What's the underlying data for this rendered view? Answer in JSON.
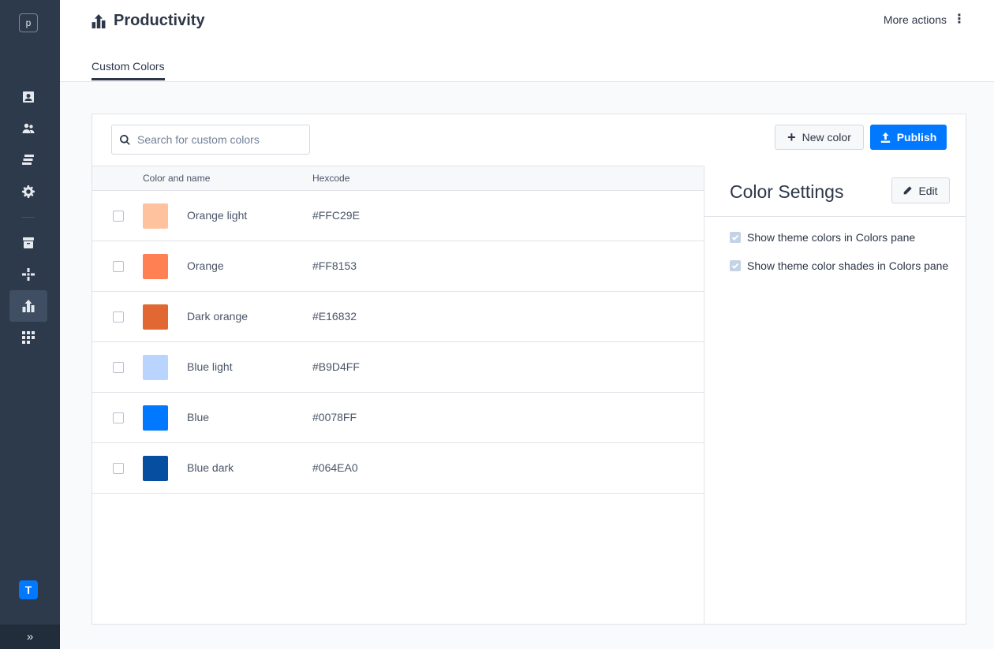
{
  "sidebar": {
    "logo": "p",
    "brand": "T",
    "expand": "»",
    "items": [
      {
        "icon": "contact-card-icon"
      },
      {
        "icon": "users-icon"
      },
      {
        "icon": "layers-icon"
      },
      {
        "icon": "gear-icon"
      },
      {
        "icon": "archive-icon"
      },
      {
        "icon": "plus-cross-icon"
      },
      {
        "icon": "productivity-icon",
        "active": true
      },
      {
        "icon": "grid-icon"
      }
    ]
  },
  "header": {
    "title": "Productivity",
    "more_actions": "More actions",
    "tab": "Custom Colors"
  },
  "toolbar": {
    "search_placeholder": "Search for custom colors",
    "new_color": "New color",
    "publish": "Publish"
  },
  "table": {
    "col_name": "Color and name",
    "col_hex": "Hexcode",
    "rows": [
      {
        "name": "Orange light",
        "hex": "#FFC29E",
        "swatch": "#FFC29E"
      },
      {
        "name": "Orange",
        "hex": "#FF8153",
        "swatch": "#FF8153"
      },
      {
        "name": "Dark orange",
        "hex": "#E16832",
        "swatch": "#E16832"
      },
      {
        "name": "Blue light",
        "hex": "#B9D4FF",
        "swatch": "#B9D4FF"
      },
      {
        "name": "Blue",
        "hex": "#0078FF",
        "swatch": "#0078FF"
      },
      {
        "name": "Blue dark",
        "hex": "#064EA0",
        "swatch": "#064EA0"
      }
    ]
  },
  "settings": {
    "title": "Color Settings",
    "edit": "Edit",
    "options": [
      {
        "label": "Show theme colors in Colors pane",
        "checked": true
      },
      {
        "label": "Show theme color shades in Colors pane",
        "checked": true
      }
    ]
  },
  "colors": {
    "sidebar_bg": "#2d3a4b",
    "accent": "#0078ff"
  }
}
